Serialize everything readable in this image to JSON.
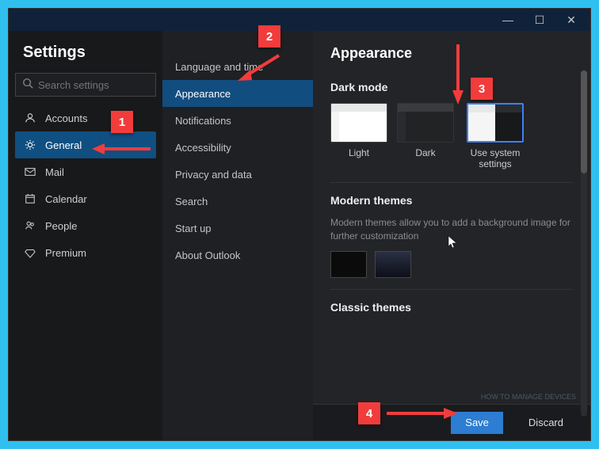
{
  "window": {
    "titlebar": {
      "min": "—",
      "max": "☐",
      "close": "✕"
    }
  },
  "settings": {
    "title": "Settings",
    "search_placeholder": "Search settings",
    "nav": [
      {
        "key": "accounts",
        "label": "Accounts",
        "icon": "person-icon"
      },
      {
        "key": "general",
        "label": "General",
        "icon": "gear-icon",
        "active": true
      },
      {
        "key": "mail",
        "label": "Mail",
        "icon": "mail-icon"
      },
      {
        "key": "calendar",
        "label": "Calendar",
        "icon": "calendar-icon"
      },
      {
        "key": "people",
        "label": "People",
        "icon": "people-icon"
      },
      {
        "key": "premium",
        "label": "Premium",
        "icon": "diamond-icon"
      }
    ]
  },
  "general": {
    "items": [
      {
        "key": "language",
        "label": "Language and time"
      },
      {
        "key": "appearance",
        "label": "Appearance",
        "active": true
      },
      {
        "key": "notifications",
        "label": "Notifications"
      },
      {
        "key": "accessibility",
        "label": "Accessibility"
      },
      {
        "key": "privacy",
        "label": "Privacy and data"
      },
      {
        "key": "search",
        "label": "Search"
      },
      {
        "key": "startup",
        "label": "Start up"
      },
      {
        "key": "about",
        "label": "About Outlook"
      }
    ]
  },
  "appearance": {
    "title": "Appearance",
    "dark_mode_label": "Dark mode",
    "dark_mode_options": [
      {
        "key": "light",
        "label": "Light"
      },
      {
        "key": "dark",
        "label": "Dark"
      },
      {
        "key": "system",
        "label": "Use system settings",
        "selected": true
      }
    ],
    "modern_themes_label": "Modern themes",
    "modern_themes_desc": "Modern themes allow you to add a background image for further customization",
    "classic_themes_label": "Classic themes"
  },
  "footer": {
    "save": "Save",
    "discard": "Discard"
  },
  "annotations": {
    "b1": "1",
    "b2": "2",
    "b3": "3",
    "b4": "4"
  },
  "watermark": "HOW TO MANAGE DEVICES"
}
